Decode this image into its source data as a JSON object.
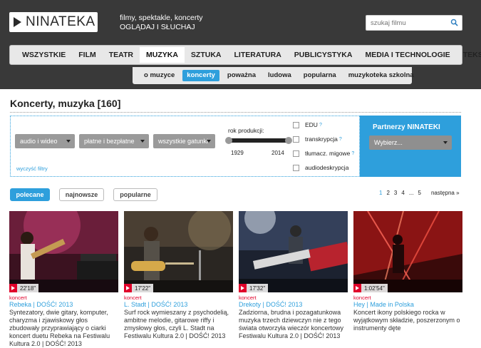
{
  "header": {
    "logo_text": "NINATEKA",
    "tagline_line1": "filmy, spektakle, koncerty",
    "tagline_line2": "OGLĄDAJ I SŁUCHAJ",
    "search_placeholder": "szukaj filmu"
  },
  "main_nav": [
    "WSZYSTKIE",
    "FILM",
    "TEATR",
    "MUZYKA",
    "SZTUKA",
    "LITERATURA",
    "PUBLICYSTYKA",
    "MEDIA I TECHNOLOGIE",
    "TEKSTY"
  ],
  "main_nav_active": "MUZYKA",
  "sub_nav": [
    "o muzyce",
    "koncerty",
    "poważna",
    "ludowa",
    "popularna",
    "muzykoteka szkolna"
  ],
  "sub_nav_active": "koncerty",
  "page_title": "Koncerty, muzyka [160]",
  "filters": {
    "select1": "audio i wideo",
    "select2": "płatne i bezpłatne",
    "select3": "wszystkie gatunki",
    "year_label": "rok produkcji:",
    "year_min": "1929",
    "year_max": "2014",
    "clear": "wyczyść filtry",
    "checks": [
      "EDU",
      "transkrypcja",
      "tłumacz. migowe",
      "audiodeskrypcja"
    ],
    "help_mark": "?"
  },
  "partners": {
    "title": "Partnerzy NINATEKI",
    "select": "Wybierz..."
  },
  "sort": {
    "recommended": "polecane",
    "newest": "najnowsze",
    "popular": "popularne"
  },
  "pagination": {
    "pages": [
      "1",
      "2",
      "3",
      "4",
      "...",
      "5"
    ],
    "next": "następna »"
  },
  "videos": [
    {
      "duration": "22'18\"",
      "category": "koncert",
      "title": "Rebeka | DOŚĆ! 2013",
      "description": "Syntezatory, dwie gitary, komputer, charyzma i zjawiskowy głos zbudowały przyprawiający o ciarki koncert duetu Rebeka na Festiwalu Kultura 2.0 | DOŚĆ! 2013"
    },
    {
      "duration": "17'22\"",
      "category": "koncert",
      "title": "L. Stadt | DOŚĆ! 2013",
      "description": "Surf rock wymieszany z psychodelią, ambitne melodie, gitarowe riffy i zmysłowy głos, czyli L. Stadt na Festiwalu Kultura 2.0 | DOŚĆ! 2013"
    },
    {
      "duration": "17'32\"",
      "category": "koncert",
      "title": "Drekoty | DOŚĆ! 2013",
      "description": "Zadziorna, brudna i pozagatunkowa muzyka trzech dziewczyn nie z tego świata otworzyła wieczór koncertowy Festiwalu Kultura 2.0 | DOŚĆ! 2013"
    },
    {
      "duration": "1:02'54\"",
      "category": "koncert",
      "title": "Hey | Made in Polska",
      "description": "Koncert ikony polskiego rocka w wyjątkowym składzie, poszerzonym o instrumenty dęte"
    }
  ]
}
